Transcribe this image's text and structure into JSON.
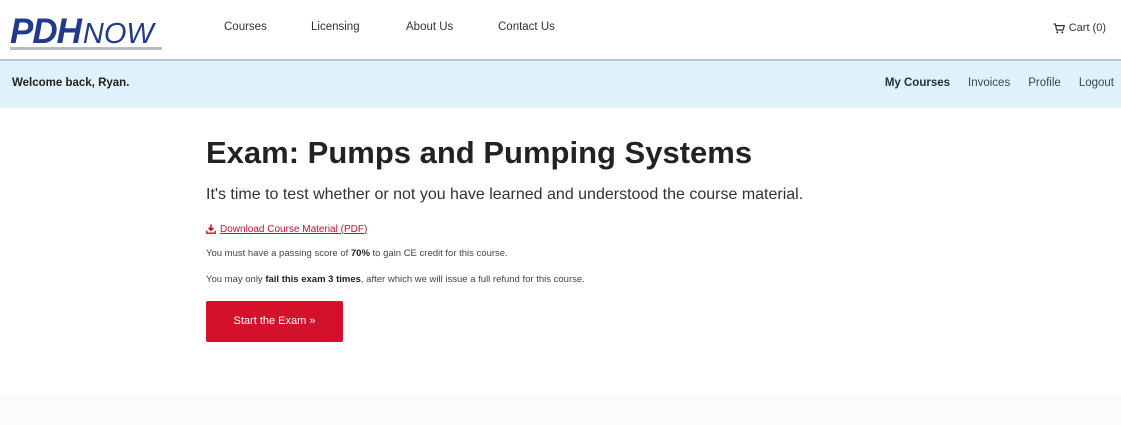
{
  "header": {
    "logo": {
      "part1": "PDH",
      "part2": "NOW"
    },
    "nav": [
      {
        "label": "Courses"
      },
      {
        "label": "Licensing"
      },
      {
        "label": "About Us"
      },
      {
        "label": "Contact Us"
      }
    ],
    "cart": {
      "label": "Cart (0)",
      "icon": "cart-icon"
    }
  },
  "welcome_bar": {
    "greeting": "Welcome back, Ryan.",
    "links": [
      {
        "label": "My Courses",
        "active": true
      },
      {
        "label": "Invoices",
        "active": false
      },
      {
        "label": "Profile",
        "active": false
      },
      {
        "label": "Logout",
        "active": false
      }
    ]
  },
  "exam": {
    "title": "Exam: Pumps and Pumping Systems",
    "subtitle": "It's time to test whether or not you have learned and understood the course material.",
    "download": {
      "label": "Download Course Material (PDF)",
      "icon": "download-icon"
    },
    "passing_note": {
      "before": "You must have a passing score of ",
      "bold": "70%",
      "after": " to gain CE credit for this course."
    },
    "fail_note": {
      "before": "You may only ",
      "bold": "fail this exam 3 times",
      "after": ", after which we will issue a full refund for this course."
    },
    "start_button": "Start the Exam »"
  },
  "colors": {
    "brand_blue": "#233a8c",
    "accent_red": "#d3112b",
    "welcome_bar_bg": "#dff1fb"
  }
}
